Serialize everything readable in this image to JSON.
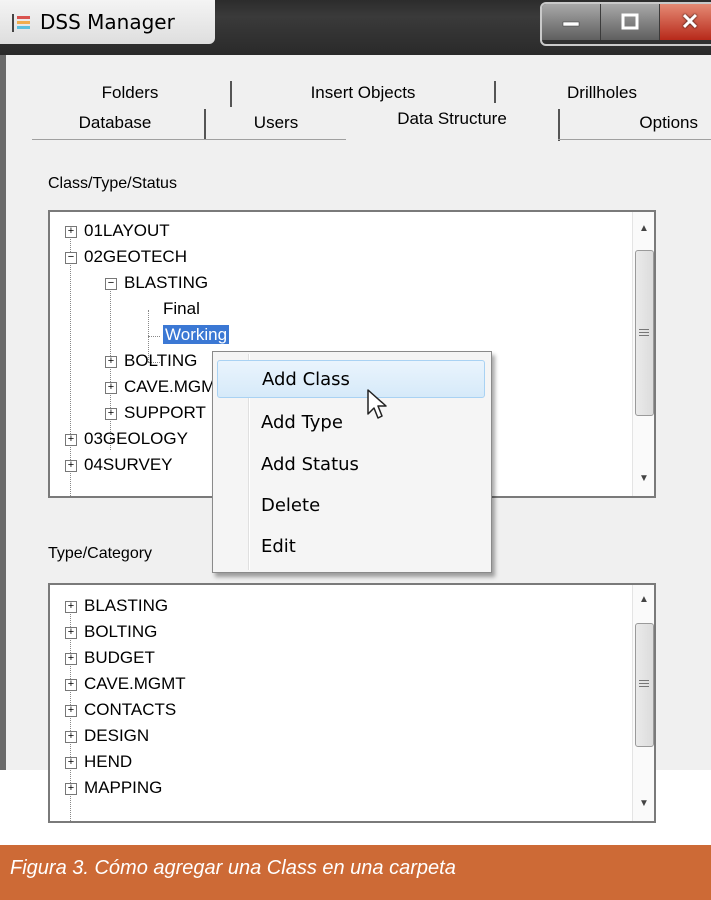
{
  "window": {
    "title": "DSS Manager"
  },
  "tabs": {
    "row1": [
      "Folders",
      "Insert Objects",
      "Drillholes"
    ],
    "row2": [
      "Database",
      "Users",
      "Data Structure",
      "Options"
    ],
    "active": "Data Structure"
  },
  "class_tree": {
    "label": "Class/Type/Status",
    "items": [
      "01LAYOUT",
      "02GEOTECH",
      "BLASTING",
      "Final",
      "Working",
      "BOLTING",
      "CAVE.MGMT",
      "SUPPORT",
      "03GEOLOGY",
      "04SURVEY"
    ],
    "selected": "Working"
  },
  "type_tree": {
    "label": "Type/Category",
    "items": [
      "BLASTING",
      "BOLTING",
      "BUDGET",
      "CAVE.MGMT",
      "CONTACTS",
      "DESIGN",
      "HEND",
      "MAPPING"
    ]
  },
  "context_menu": {
    "items": [
      "Add Class",
      "Add Type",
      "Add Status",
      "Delete",
      "Edit"
    ],
    "hovered": "Add Class"
  },
  "caption": "Figura 3. Cómo agregar una Class en una carpeta",
  "colors": {
    "selection": "#3b78d4",
    "caption_bg": "#cd6a36",
    "menu_hover": "#d6eaf9"
  },
  "icons": [
    "app-icon",
    "minimize-icon",
    "maximize-icon",
    "close-icon",
    "expand-icon",
    "collapse-icon",
    "scroll-up-icon",
    "scroll-down-icon",
    "mouse-pointer-icon"
  ]
}
